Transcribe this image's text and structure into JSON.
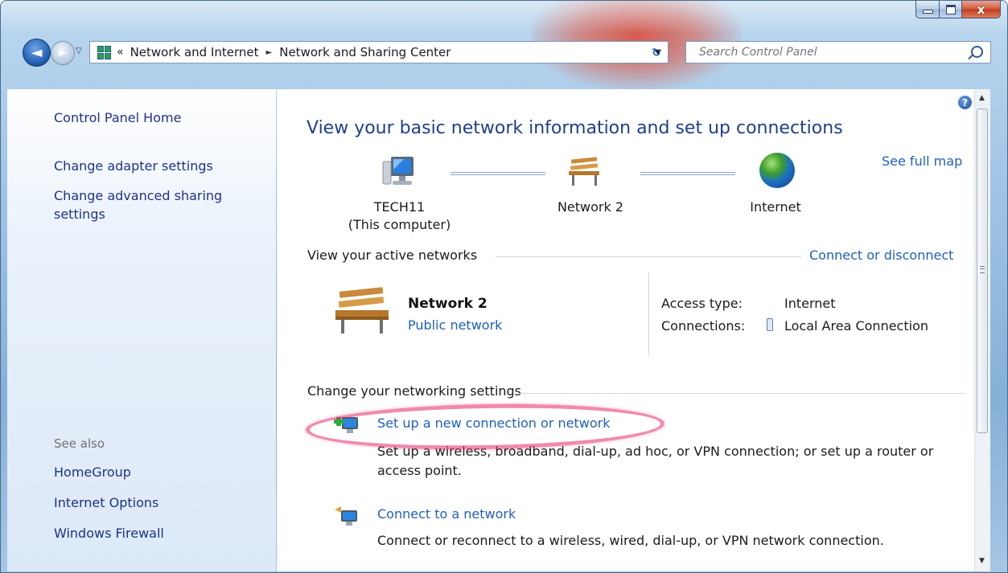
{
  "window": {
    "minimize_glyph": "–",
    "close_glyph": "x"
  },
  "nav": {
    "back_glyph": "◄",
    "forward_glyph": "►",
    "history_glyph": "▽",
    "address_chevron": "«",
    "breadcrumb": [
      "Network and Internet",
      "Network and Sharing Center"
    ],
    "breadcrumb_sep": "►",
    "dropdown_glyph": "▼",
    "refresh_glyph": "↻",
    "search_placeholder": "Search Control Panel"
  },
  "sidebar": {
    "home": "Control Panel Home",
    "links": [
      "Change adapter settings",
      "Change advanced sharing settings"
    ],
    "see_also_label": "See also",
    "see_also": [
      "HomeGroup",
      "Internet Options",
      "Windows Firewall"
    ]
  },
  "main": {
    "help_glyph": "?",
    "title": "View your basic network information and set up connections",
    "see_full_map": "See full map",
    "map": {
      "computer_name": "TECH11",
      "computer_sub": "(This computer)",
      "network": "Network  2",
      "internet": "Internet"
    },
    "active_networks": {
      "heading": "View your active networks",
      "action": "Connect or disconnect",
      "network_name": "Network  2",
      "network_type": "Public network",
      "access_label": "Access type:",
      "access_value": "Internet",
      "connections_label": "Connections:",
      "connections_value": "Local Area Connection"
    },
    "settings": {
      "heading": "Change your networking settings",
      "tasks": [
        {
          "link": "Set up a new connection or network",
          "desc": "Set up a wireless, broadband, dial-up, ad hoc, or VPN connection; or set up a router or access point."
        },
        {
          "link": "Connect to a network",
          "desc": "Connect or reconnect to a wireless, wired, dial-up, or VPN network connection."
        }
      ]
    }
  },
  "scrollbar": {
    "up_glyph": "▲",
    "down_glyph": "▼"
  },
  "colors": {
    "link": "#1f5fbf",
    "title": "#1e3f8f",
    "sidebar_link": "#1e3287",
    "highlight": "#e6286e"
  }
}
